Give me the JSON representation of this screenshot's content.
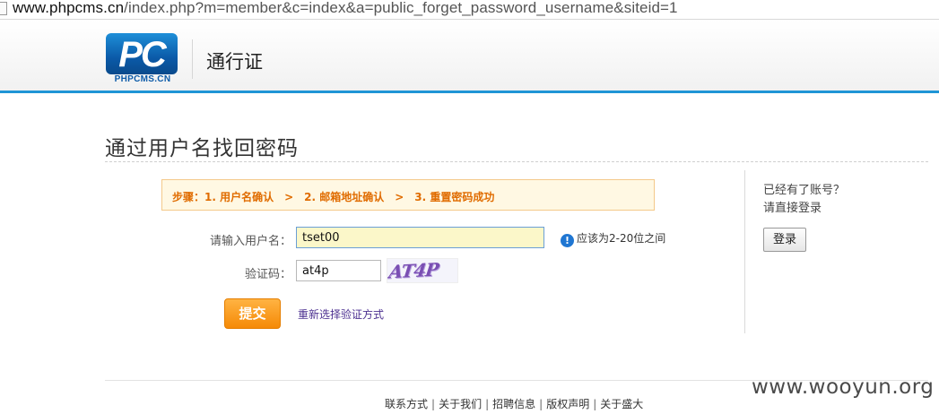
{
  "browser": {
    "url_host": "www.phpcms.cn",
    "url_path": "/index.php?m=member&c=index&a=public_forget_password_username&siteid=1"
  },
  "header": {
    "logo_text": "PC",
    "logo_sub": "PHPCMS.CN",
    "title": "通行证"
  },
  "page": {
    "title": "通过用户名找回密码",
    "steps": "步骤：1. 用户名确认　>　2. 邮箱地址确认　>　3. 重置密码成功"
  },
  "form": {
    "username_label": "请输入用户名：",
    "username_value": "tset00",
    "username_hint": "应该为2-20位之间",
    "captcha_label": "验证码：",
    "captcha_value": "at4p",
    "captcha_image_text": "AT4P",
    "submit_label": "提交",
    "reselect_link": "重新选择验证方式"
  },
  "sidebar": {
    "question": "已经有了账号？",
    "prompt": "请直接登录",
    "login_label": "登录"
  },
  "footer": {
    "links": [
      "联系方式",
      "关于我们",
      "招聘信息",
      "版权声明",
      "关于盛大"
    ]
  },
  "watermark": "www.wooyun.org",
  "colors": {
    "accent_blue": "#1f95d6",
    "steps_orange": "#e06c00",
    "submit_orange": "#f58a07"
  }
}
